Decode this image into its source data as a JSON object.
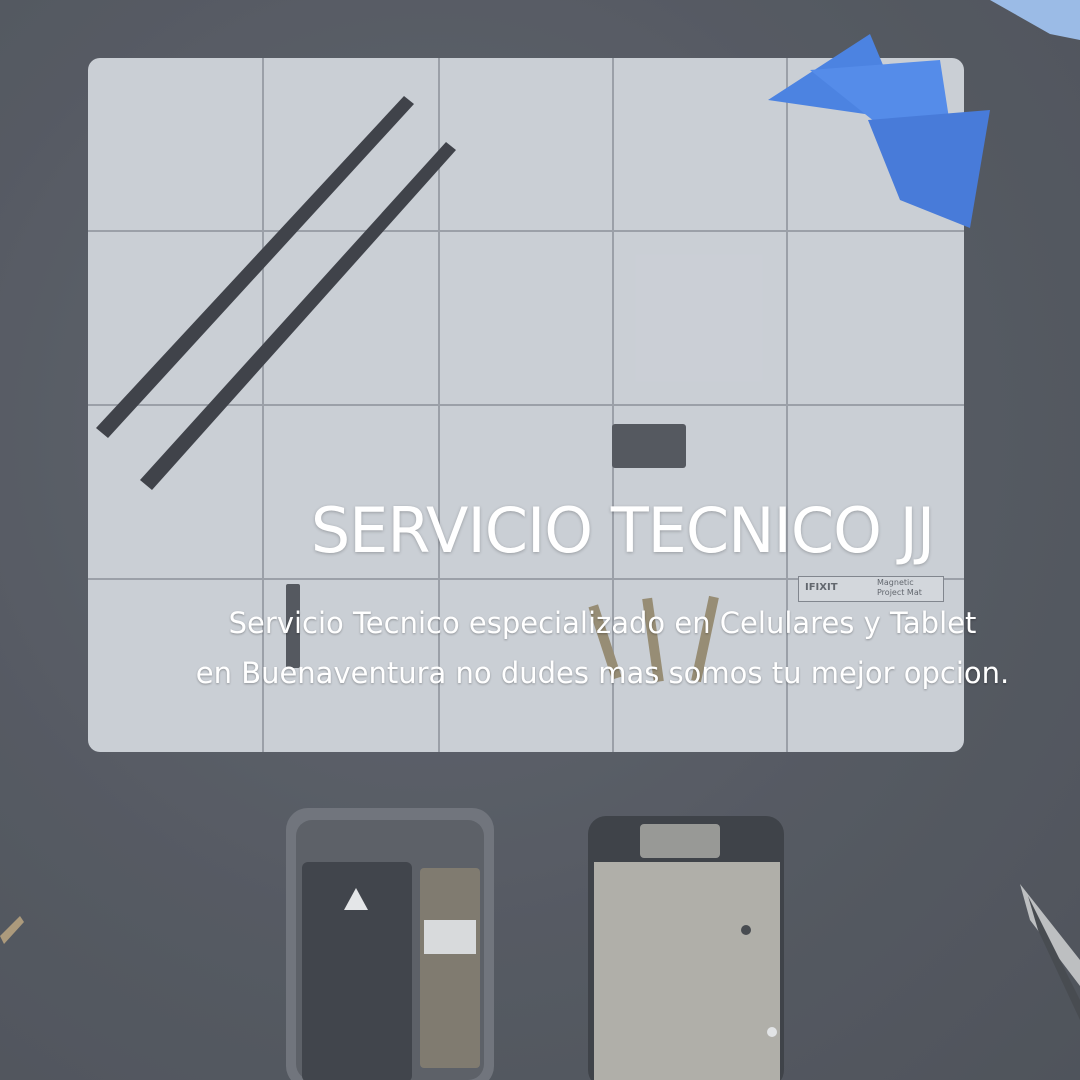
{
  "hero": {
    "title": "SERVICIO TECNICO JJ",
    "subtitle_line1": "Servicio Tecnico especializado en Celulares y Tablet",
    "subtitle_line2": "en Buenaventura no dudes mas somos tu mejor opcion.",
    "mat_brand": "IFIXIT",
    "mat_label_line1": "Magnetic",
    "mat_label_line2": "Project Mat"
  },
  "colors": {
    "background": "#3a3d45",
    "mat": "#c9ccd1",
    "pick": "#2f6fe0",
    "text": "#ffffff"
  }
}
